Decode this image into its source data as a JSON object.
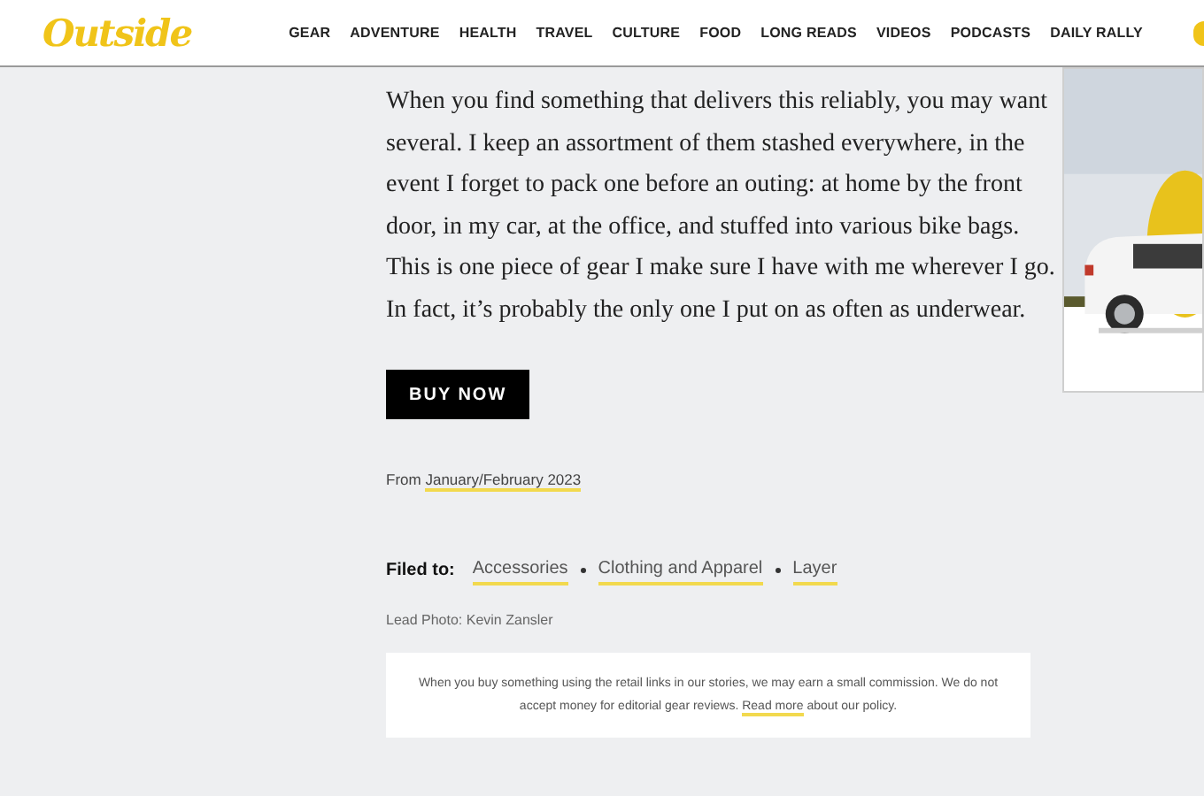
{
  "header": {
    "logo": "Outside",
    "nav": [
      "GEAR",
      "ADVENTURE",
      "HEALTH",
      "TRAVEL",
      "CULTURE",
      "FOOD",
      "LONG READS",
      "VIDEOS",
      "PODCASTS",
      "DAILY RALLY"
    ]
  },
  "article": {
    "paragraph": "When you find something that delivers this reliably, you may want several. I keep an assortment of them stashed everywhere, in the event I forget to pack one before an outing: at home by the front door, in my car, at the office, and stuffed into various bike bags. This is one piece of gear I make sure I have with me wherever I go. In fact, it’s probably the only one I put on as often as underwear.",
    "button": "BUY NOW",
    "issue": {
      "prefix": "From",
      "link": "January/February 2023"
    },
    "filed": {
      "label": "Filed to:",
      "tags": [
        "Accessories",
        "Clothing and Apparel",
        "Layer"
      ]
    },
    "credit": "Lead Photo: Kevin Zansler",
    "disclosure": {
      "before": "When you buy something using the retail links in our stories, we may earn a small commission. We do not accept money for editorial gear reviews.",
      "link": "Read more",
      "after": "about our policy."
    }
  }
}
